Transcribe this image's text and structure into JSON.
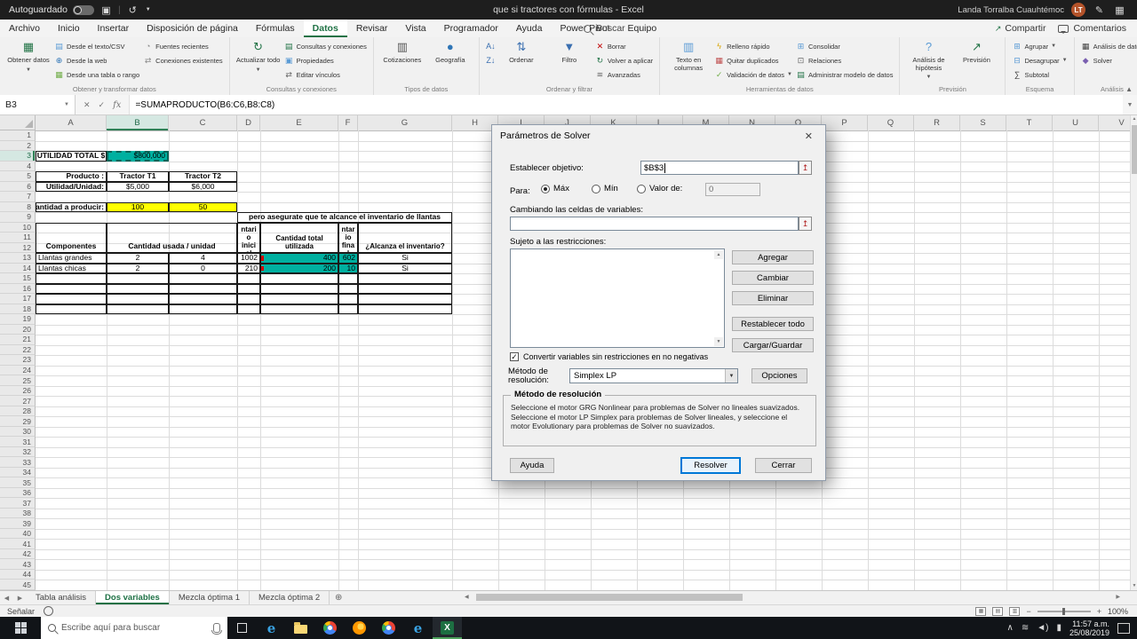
{
  "app": {
    "accent_green": "#217346",
    "teal_fill": "#00b0a0",
    "yellow_fill": "#ffff00"
  },
  "titlebar": {
    "autosave_label": "Autoguardado",
    "title": "que si tractores con fórmulas - Excel",
    "user": {
      "name": "Landa Torralba Cuauhtémoc",
      "initials": "LT"
    }
  },
  "ribbon": {
    "tabs": [
      "Archivo",
      "Inicio",
      "Insertar",
      "Disposición de página",
      "Fórmulas",
      "Datos",
      "Revisar",
      "Vista",
      "Programador",
      "Ayuda",
      "Power Pivot",
      "Equipo"
    ],
    "active_tab": "Datos",
    "search_label": "Buscar",
    "share_label": "Compartir",
    "comments_label": "Comentarios",
    "icon_map": {
      "get-data": [
        "▦",
        "#217346"
      ],
      "text-csv": [
        "▤",
        "#5b9bd5"
      ],
      "web": [
        "⊕",
        "#2e75b6"
      ],
      "table-range": [
        "▦",
        "#70ad47"
      ],
      "recent-sources": [
        "◔",
        "#8a8a8a"
      ],
      "existing-connections": [
        "⇄",
        "#8a8a8a"
      ],
      "refresh": [
        "↻",
        "#217346"
      ],
      "queries": [
        "▤",
        "#217346"
      ],
      "properties": [
        "▣",
        "#5b9bd5"
      ],
      "edit-links": [
        "⇄",
        "#666666"
      ],
      "stocks": [
        "▥",
        "#555555"
      ],
      "geography": [
        "●",
        "#2e75b6"
      ],
      "sort-az": [
        "A↓",
        "#3a6fb0"
      ],
      "sort-za": [
        "Z↓",
        "#3a6fb0"
      ],
      "sort": [
        "⇅",
        "#3a6fb0"
      ],
      "filter": [
        "▼",
        "#3a6fb0"
      ],
      "clear": [
        "✕",
        "#c00000"
      ],
      "reapply": [
        "↻",
        "#217346"
      ],
      "advanced": [
        "≋",
        "#666666"
      ],
      "text-columns": [
        "▥",
        "#5b9bd5"
      ],
      "flash-fill": [
        "ϟ",
        "#d9a300"
      ],
      "remove-duplicates": [
        "▦",
        "#c05050"
      ],
      "data-validation": [
        "✓",
        "#70ad47"
      ],
      "consolidate": [
        "⊞",
        "#5b9bd5"
      ],
      "relationships": [
        "⊡",
        "#666666"
      ],
      "data-model": [
        "▤",
        "#217346"
      ],
      "what-if": [
        "?",
        "#5b9bd5"
      ],
      "forecast": [
        "↗",
        "#217346"
      ],
      "group": [
        "⊞",
        "#5b9bd5"
      ],
      "ungroup": [
        "⊟",
        "#5b9bd5"
      ],
      "subtotal": [
        "∑",
        "#444444"
      ],
      "data-analysis": [
        "▦",
        "#444444"
      ],
      "solver": [
        "◆",
        "#7a5fb0"
      ]
    },
    "groups": [
      {
        "label": "Obtener y transformar datos",
        "items": [
          {
            "kind": "big",
            "label": "Obtener datos",
            "icon": "get-data",
            "arrow": true
          },
          {
            "kind": "col",
            "items": [
              {
                "label": "Desde el texto/CSV",
                "icon": "text-csv"
              },
              {
                "label": "Desde la web",
                "icon": "web"
              },
              {
                "label": "Desde una tabla o rango",
                "icon": "table-range"
              }
            ]
          },
          {
            "kind": "col",
            "items": [
              {
                "label": "Fuentes recientes",
                "icon": "recent-sources"
              },
              {
                "label": "Conexiones existentes",
                "icon": "existing-connections"
              }
            ]
          }
        ]
      },
      {
        "label": "Consultas y conexiones",
        "items": [
          {
            "kind": "big",
            "label": "Actualizar todo",
            "icon": "refresh",
            "arrow": true
          },
          {
            "kind": "col",
            "items": [
              {
                "label": "Consultas y conexiones",
                "icon": "queries"
              },
              {
                "label": "Propiedades",
                "icon": "properties"
              },
              {
                "label": "Editar vínculos",
                "icon": "edit-links"
              }
            ]
          }
        ]
      },
      {
        "label": "Tipos de datos",
        "items": [
          {
            "kind": "big",
            "label": "Cotizaciones",
            "icon": "stocks"
          },
          {
            "kind": "big",
            "label": "Geografía",
            "icon": "geography"
          }
        ]
      },
      {
        "label": "Ordenar y filtrar",
        "items": [
          {
            "kind": "col",
            "items": [
              {
                "label": "",
                "icon": "sort-az"
              },
              {
                "label": "",
                "icon": "sort-za"
              }
            ]
          },
          {
            "kind": "big",
            "label": "Ordenar",
            "icon": "sort"
          },
          {
            "kind": "big",
            "label": "Filtro",
            "icon": "filter"
          },
          {
            "kind": "col",
            "items": [
              {
                "label": "Borrar",
                "icon": "clear"
              },
              {
                "label": "Volver a aplicar",
                "icon": "reapply"
              },
              {
                "label": "Avanzadas",
                "icon": "advanced"
              }
            ]
          }
        ]
      },
      {
        "label": "Herramientas de datos",
        "items": [
          {
            "kind": "big",
            "label": "Texto en columnas",
            "icon": "text-columns"
          },
          {
            "kind": "col",
            "items": [
              {
                "label": "Relleno rápido",
                "icon": "flash-fill"
              },
              {
                "label": "Quitar duplicados",
                "icon": "remove-duplicates"
              },
              {
                "label": "Validación de datos",
                "icon": "data-validation",
                "arrow": true
              }
            ]
          },
          {
            "kind": "col",
            "items": [
              {
                "label": "Consolidar",
                "icon": "consolidate"
              },
              {
                "label": "Relaciones",
                "icon": "relationships"
              },
              {
                "label": "Administrar modelo de datos",
                "icon": "data-model"
              }
            ]
          }
        ]
      },
      {
        "label": "Previsión",
        "items": [
          {
            "kind": "big",
            "label": "Análisis de hipótesis",
            "icon": "what-if",
            "arrow": true
          },
          {
            "kind": "big",
            "label": "Previsión",
            "icon": "forecast"
          }
        ]
      },
      {
        "label": "Esquema",
        "items": [
          {
            "kind": "col",
            "items": [
              {
                "label": "Agrupar",
                "icon": "group",
                "arrow": true
              },
              {
                "label": "Desagrupar",
                "icon": "ungroup",
                "arrow": true
              },
              {
                "label": "Subtotal",
                "icon": "subtotal"
              }
            ]
          }
        ]
      },
      {
        "label": "Análisis",
        "items": [
          {
            "kind": "col",
            "items": [
              {
                "label": "Análisis de datos",
                "icon": "data-analysis"
              },
              {
                "label": "Solver",
                "icon": "solver"
              }
            ]
          }
        ]
      }
    ]
  },
  "formula_bar": {
    "cell_ref": "B3",
    "formula": "=SUMAPRODUCTO(B6:C6,B8:C8)"
  },
  "grid": {
    "columns": [
      "A",
      "B",
      "C",
      "D",
      "E",
      "F",
      "G",
      "H",
      "I",
      "J",
      "K",
      "L",
      "M",
      "N",
      "O",
      "P",
      "Q",
      "R",
      "S",
      "T",
      "U",
      "V"
    ],
    "row_count": 45,
    "active_col": "B",
    "active_row": 3,
    "cells": [
      {
        "r": 3,
        "c": "A",
        "text": "UTILIDAD TOTAL $",
        "bold": true,
        "align": "center",
        "border": true
      },
      {
        "r": 3,
        "c": "B",
        "text": "$800,000",
        "align": "right",
        "bg": "#00b0a0",
        "border": true,
        "ants": true
      },
      {
        "r": 5,
        "c": "A",
        "text": "Producto :",
        "bold": true,
        "align": "right",
        "border": true
      },
      {
        "r": 5,
        "c": "B",
        "text": "Tractor T1",
        "bold": true,
        "align": "center",
        "border": true
      },
      {
        "r": 5,
        "c": "C",
        "text": "Tractor T2",
        "bold": true,
        "align": "center",
        "border": true
      },
      {
        "r": 6,
        "c": "A",
        "text": "Utilidad/Unidad:",
        "bold": true,
        "align": "right",
        "border": true
      },
      {
        "r": 6,
        "c": "B",
        "text": "$5,000",
        "align": "center",
        "border": true
      },
      {
        "r": 6,
        "c": "C",
        "text": "$6,000",
        "align": "center",
        "border": true
      },
      {
        "r": 8,
        "c": "A",
        "text": "Cantidad a producir:",
        "bold": true,
        "align": "right",
        "border": true
      },
      {
        "r": 8,
        "c": "B",
        "text": "100",
        "align": "center",
        "bg": "#ffff00",
        "border": true
      },
      {
        "r": 8,
        "c": "C",
        "text": "50",
        "align": "center",
        "bg": "#ffff00",
        "border": true
      },
      {
        "r": 9,
        "c": "D",
        "c2": "G",
        "text": "pero asegurate que te alcance el inventario de llantas",
        "bold": true,
        "align": "center",
        "border": true
      },
      {
        "r": 10,
        "r2": 12,
        "c": "A",
        "text": "Componentes",
        "bold": true,
        "align": "center",
        "valign": "bottom",
        "border": true
      },
      {
        "r": 10,
        "r2": 12,
        "c": "B",
        "c2": "C",
        "text": "Cantidad usada / unidad",
        "bold": true,
        "align": "center",
        "valign": "bottom",
        "border": true
      },
      {
        "r": 10,
        "r2": 12,
        "c": "D",
        "text": "Inventario inicial",
        "bold": true,
        "align": "center",
        "wrap": true,
        "border": true
      },
      {
        "r": 10,
        "r2": 12,
        "c": "E",
        "text": "Cantidad total utilizada",
        "bold": true,
        "align": "center",
        "valign": "bottom",
        "wrap": true,
        "border": true
      },
      {
        "r": 10,
        "r2": 12,
        "c": "F",
        "text": "Inventario final",
        "bold": true,
        "align": "center",
        "wrap": true,
        "border": true
      },
      {
        "r": 10,
        "r2": 12,
        "c": "G",
        "text": "¿Alcanza el inventario?",
        "bold": true,
        "align": "center",
        "valign": "bottom",
        "wrap": true,
        "border": true
      },
      {
        "r": 13,
        "c": "A",
        "text": "Llantas grandes",
        "border": true
      },
      {
        "r": 13,
        "c": "B",
        "text": "2",
        "align": "center",
        "border": true
      },
      {
        "r": 13,
        "c": "C",
        "text": "4",
        "align": "center",
        "border": true
      },
      {
        "r": 13,
        "c": "D",
        "text": "1002",
        "align": "right",
        "border": true
      },
      {
        "r": 13,
        "c": "E",
        "text": "400",
        "align": "right",
        "bg": "#00b0a0",
        "border": true,
        "redmark": true
      },
      {
        "r": 13,
        "c": "F",
        "text": "602",
        "align": "right",
        "bg": "#00b0a0",
        "border": true
      },
      {
        "r": 13,
        "c": "G",
        "text": "Si",
        "align": "center",
        "border": true
      },
      {
        "r": 14,
        "c": "A",
        "text": "Llantas chicas",
        "border": true
      },
      {
        "r": 14,
        "c": "B",
        "text": "2",
        "align": "center",
        "border": true
      },
      {
        "r": 14,
        "c": "C",
        "text": "0",
        "align": "center",
        "border": true
      },
      {
        "r": 14,
        "c": "D",
        "text": "210",
        "align": "right",
        "border": true
      },
      {
        "r": 14,
        "c": "E",
        "text": "200",
        "align": "right",
        "bg": "#00b0a0",
        "border": true,
        "redmark": true
      },
      {
        "r": 14,
        "c": "F",
        "text": "10",
        "align": "right",
        "bg": "#00b0a0",
        "border": true
      },
      {
        "r": 14,
        "c": "G",
        "text": "Si",
        "align": "center",
        "border": true
      }
    ],
    "bordered_empty_range": {
      "r1": 15,
      "r2": 18,
      "c1": "A",
      "c2": "G"
    }
  },
  "solver": {
    "title": "Parámetros de Solver",
    "objective_label": "Establecer objetivo:",
    "objective_value": "$B$3",
    "to_label": "Para:",
    "to_options": {
      "max": "Máx",
      "min": "Mín",
      "value_of": "Valor de:"
    },
    "to_selected": "max",
    "value_of_value": "0",
    "variables_label": "Cambiando las celdas de variables:",
    "variables_value": "",
    "constraints_label": "Sujeto a las restricciones:",
    "constraints": [],
    "side_buttons": {
      "add": "Agregar",
      "change": "Cambiar",
      "remove": "Eliminar",
      "reset": "Restablecer todo",
      "load_save": "Cargar/Guardar"
    },
    "unconstrained_checkbox_label": "Convertir variables sin restricciones en no negativas",
    "unconstrained_checked": true,
    "method_label": "Método de resolución:",
    "method_value": "Simplex LP",
    "options_button": "Opciones",
    "method_box_title": "Método de resolución",
    "method_box_text": "Seleccione el motor GRG Nonlinear para problemas de Solver no lineales suavizados. Seleccione el motor LP Simplex para problemas de Solver lineales, y seleccione el motor Evolutionary para problemas de Solver no suavizados.",
    "footer_buttons": {
      "help": "Ayuda",
      "solve": "Resolver",
      "close": "Cerrar"
    }
  },
  "sheet_tabs": {
    "tabs": [
      "Tabla análisis",
      "Dos variables",
      "Mezcla óptima 1",
      "Mezcla óptima 2"
    ],
    "active": "Dos variables"
  },
  "status_bar": {
    "mode": "Señalar",
    "zoom": "100%"
  },
  "taskbar": {
    "search_placeholder": "Escribe aquí para buscar",
    "apps": [
      "edge",
      "file-explorer",
      "chrome",
      "firefox",
      "chrome-2",
      "edge-2",
      "excel"
    ],
    "active_app": "excel",
    "time": "11:57 a.m.",
    "date": "25/08/2019"
  }
}
